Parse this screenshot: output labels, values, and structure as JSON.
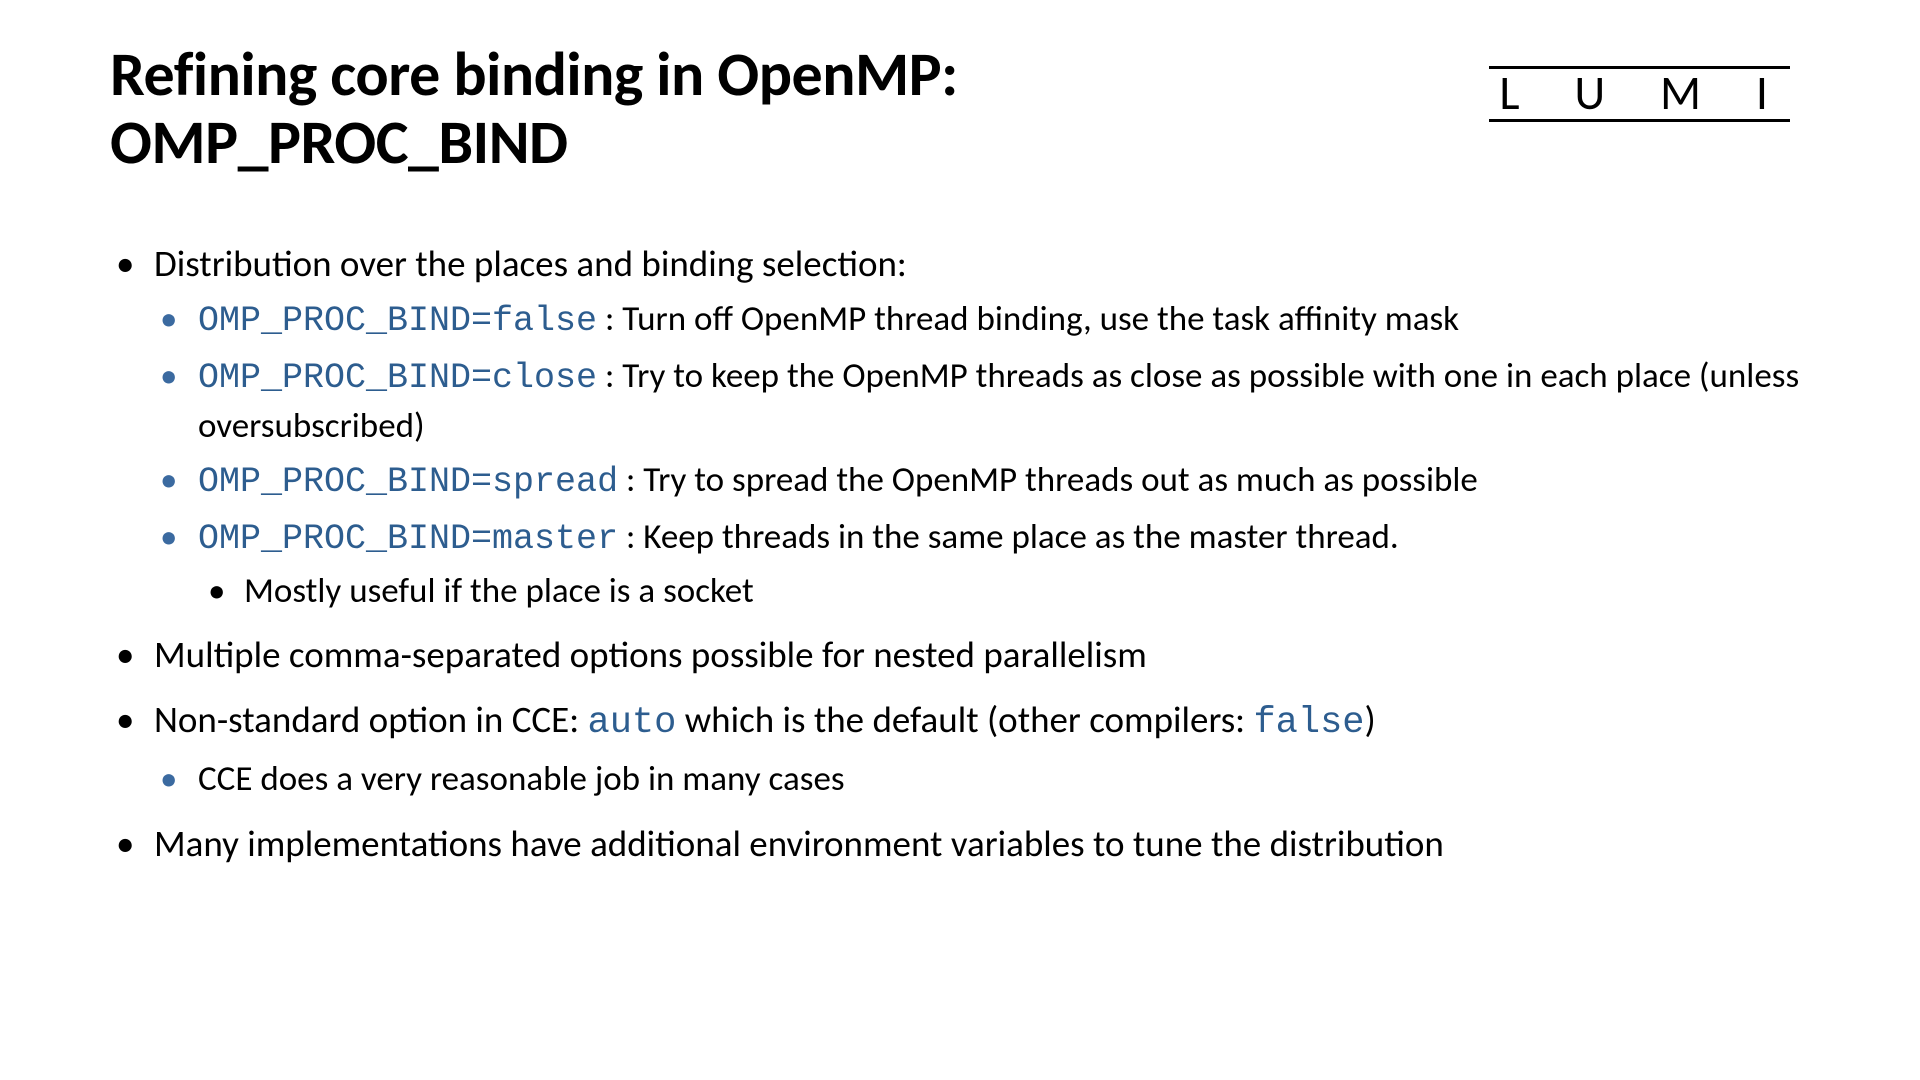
{
  "title_line1": "Refining core binding in OpenMP:",
  "title_line2": "OMP_PROC_BIND",
  "logo": "L U M I",
  "b1": {
    "text": "Distribution over the places and binding selection:",
    "sub": {
      "s1_code": "OMP_PROC_BIND=false",
      "s1_rest": " : Turn off OpenMP thread binding, use the task affinity mask",
      "s2_code": "OMP_PROC_BIND=close",
      "s2_rest": " : Try to keep the OpenMP threads as close as possible with one in each place (unless oversubscribed)",
      "s3_code": "OMP_PROC_BIND=spread",
      "s3_rest": " : Try to spread the OpenMP threads out as much as possible",
      "s4_code": "OMP_PROC_BIND=master",
      "s4_rest": " : Keep threads in the same place as the master thread.",
      "s4_sub1": "Mostly useful if the place is a socket"
    }
  },
  "b2": "Multiple comma-separated options possible for nested parallelism",
  "b3": {
    "pre": "Non-standard option in CCE: ",
    "code1": "auto",
    "mid": " which is the default (other compilers: ",
    "code2": "false",
    "post": ")",
    "sub1": "CCE does a very reasonable job in many cases"
  },
  "b4": "Many implementations have additional environment variables to tune the distribution"
}
